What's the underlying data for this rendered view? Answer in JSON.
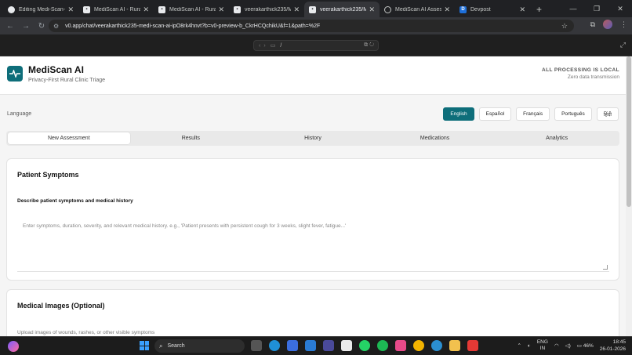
{
  "browser": {
    "tabs": [
      {
        "label": "Editing Medi-Scan-AI",
        "fav": "gh",
        "active": false
      },
      {
        "label": "MediScan AI - Rural C",
        "fav": "v0",
        "active": false
      },
      {
        "label": "MediScan AI - Rural C",
        "fav": "v0",
        "active": false
      },
      {
        "label": "veerakarthick235/Me",
        "fav": "v0",
        "active": false
      },
      {
        "label": "veerakarthick235/Me",
        "fav": "v0",
        "active": true
      },
      {
        "label": "MediScan AI Assessm",
        "fav": "globe",
        "active": false
      },
      {
        "label": "Devpost",
        "fav": "d",
        "active": false
      }
    ],
    "url": "v0.app/chat/veerakarthick235-medi-scan-ai-ipO8rk4hnvt?b=v0-preview-b_CkrHCQchikU&f=1&path=%2F",
    "preview_path": "/"
  },
  "app": {
    "title": "MediScan AI",
    "subtitle": "Privacy-First Rural Clinic Triage",
    "local_badge": "ALL PROCESSING IS LOCAL",
    "local_sub": "Zero data transmission",
    "language_label": "Language",
    "languages": [
      "English",
      "Español",
      "Français",
      "Português",
      "हिंदी"
    ],
    "selected_language": "English",
    "tabs": [
      "New Assessment",
      "Results",
      "History",
      "Medications",
      "Analytics"
    ],
    "active_tab": "New Assessment",
    "symptoms_card": {
      "title": "Patient Symptoms",
      "field_label": "Describe patient symptoms and medical history",
      "placeholder": "Enter symptoms, duration, severity, and relevant medical history. e.g., 'Patient presents with persistent cough for 3 weeks, slight fever, fatigue...'"
    },
    "images_card": {
      "title": "Medical Images (Optional)",
      "hint": "Upload images of wounds, rashes, or other visible symptoms"
    },
    "accent_color": "#0e6e7a"
  },
  "taskbar": {
    "search": "Search",
    "lang_top": "ENG",
    "lang_bottom": "IN",
    "battery": "46%",
    "time": "18:45",
    "date": "26-01-2026",
    "notification_count": "1"
  }
}
